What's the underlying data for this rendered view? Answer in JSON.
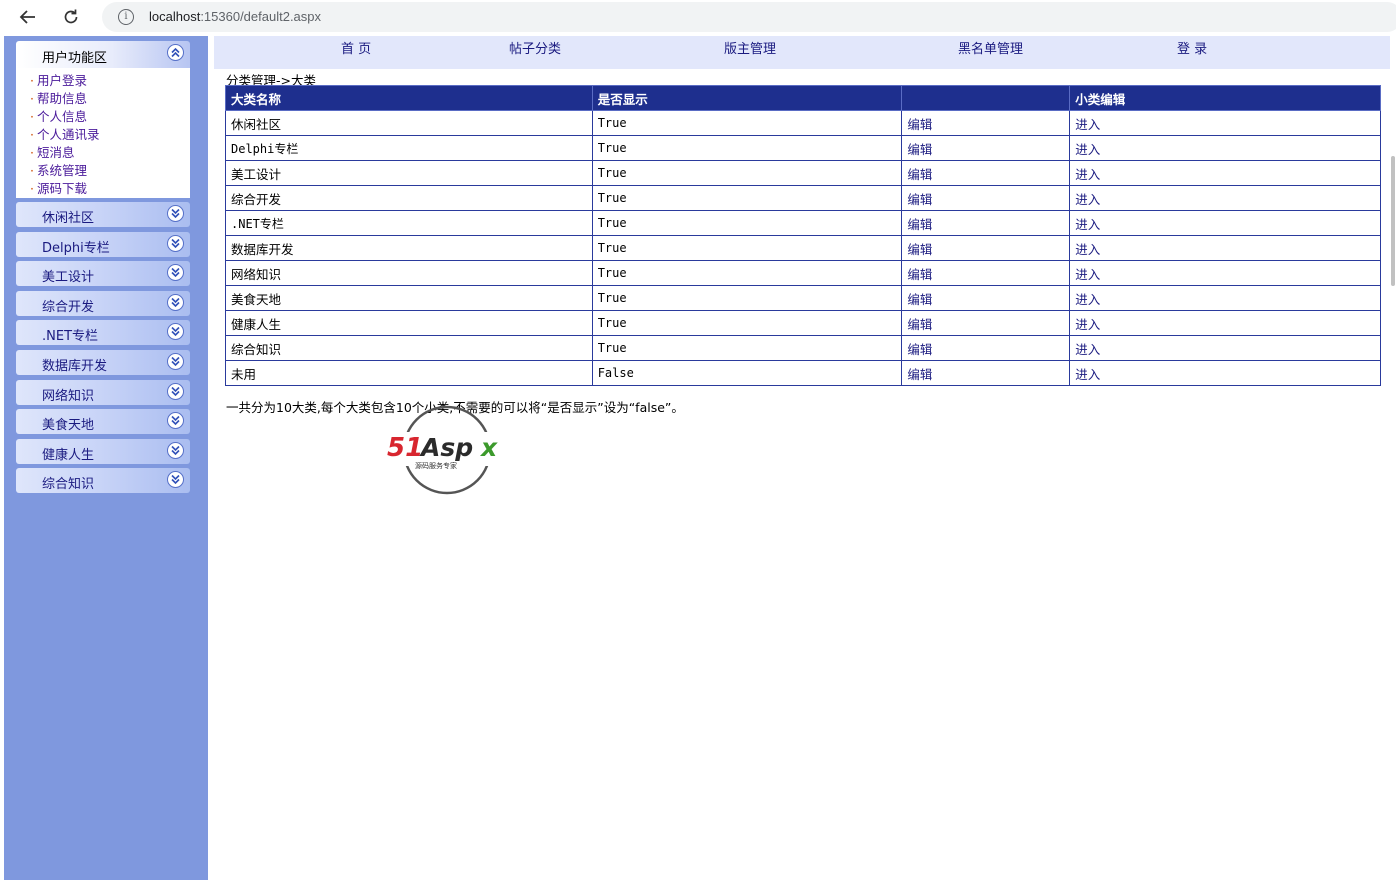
{
  "browser": {
    "url_host": "localhost",
    "url_rest": ":15360/default2.aspx"
  },
  "sidebar": {
    "header": "用户功能区",
    "user_items": [
      "用户登录",
      "帮助信息",
      "个人信息",
      "个人通讯录",
      "短消息",
      "系统管理",
      "源码下载"
    ],
    "categories": [
      "休闲社区",
      "Delphi专栏",
      "美工设计",
      "综合开发",
      ".NET专栏",
      "数据库开发",
      "网络知识",
      "美食天地",
      "健康人生",
      "综合知识"
    ]
  },
  "topnav": {
    "home": "首 页",
    "posts": "帖子分类",
    "moderators": "版主管理",
    "blacklist": "黑名单管理",
    "login": "登 录"
  },
  "breadcrumb": "分类管理->大类",
  "table": {
    "headers": [
      "大类名称",
      "是否显示",
      "",
      "小类编辑"
    ],
    "rows": [
      {
        "name": "休闲社区",
        "show": "True",
        "edit": "编辑",
        "enter": "进入"
      },
      {
        "name": "Delphi专栏",
        "show": "True",
        "edit": "编辑",
        "enter": "进入"
      },
      {
        "name": "美工设计",
        "show": "True",
        "edit": "编辑",
        "enter": "进入"
      },
      {
        "name": "综合开发",
        "show": "True",
        "edit": "编辑",
        "enter": "进入"
      },
      {
        "name": ".NET专栏",
        "show": "True",
        "edit": "编辑",
        "enter": "进入"
      },
      {
        "name": "数据库开发",
        "show": "True",
        "edit": "编辑",
        "enter": "进入"
      },
      {
        "name": "网络知识",
        "show": "True",
        "edit": "编辑",
        "enter": "进入"
      },
      {
        "name": "美食天地",
        "show": "True",
        "edit": "编辑",
        "enter": "进入"
      },
      {
        "name": "健康人生",
        "show": "True",
        "edit": "编辑",
        "enter": "进入"
      },
      {
        "name": "综合知识",
        "show": "True",
        "edit": "编辑",
        "enter": "进入"
      },
      {
        "name": "未用",
        "show": "False",
        "edit": "编辑",
        "enter": "进入"
      }
    ]
  },
  "note": "一共分为10大类,每个大类包含10个小类,不需要的可以将“是否显示”设为“false”。",
  "watermark": {
    "logo_text": "51Aspx",
    "tagline": "源码服务专家"
  },
  "colors": {
    "sidebar_bg": "#7f98de",
    "table_header_bg": "#1e2f8e",
    "topnav_bg": "#e2e7fb",
    "link": "#1a1a80"
  }
}
